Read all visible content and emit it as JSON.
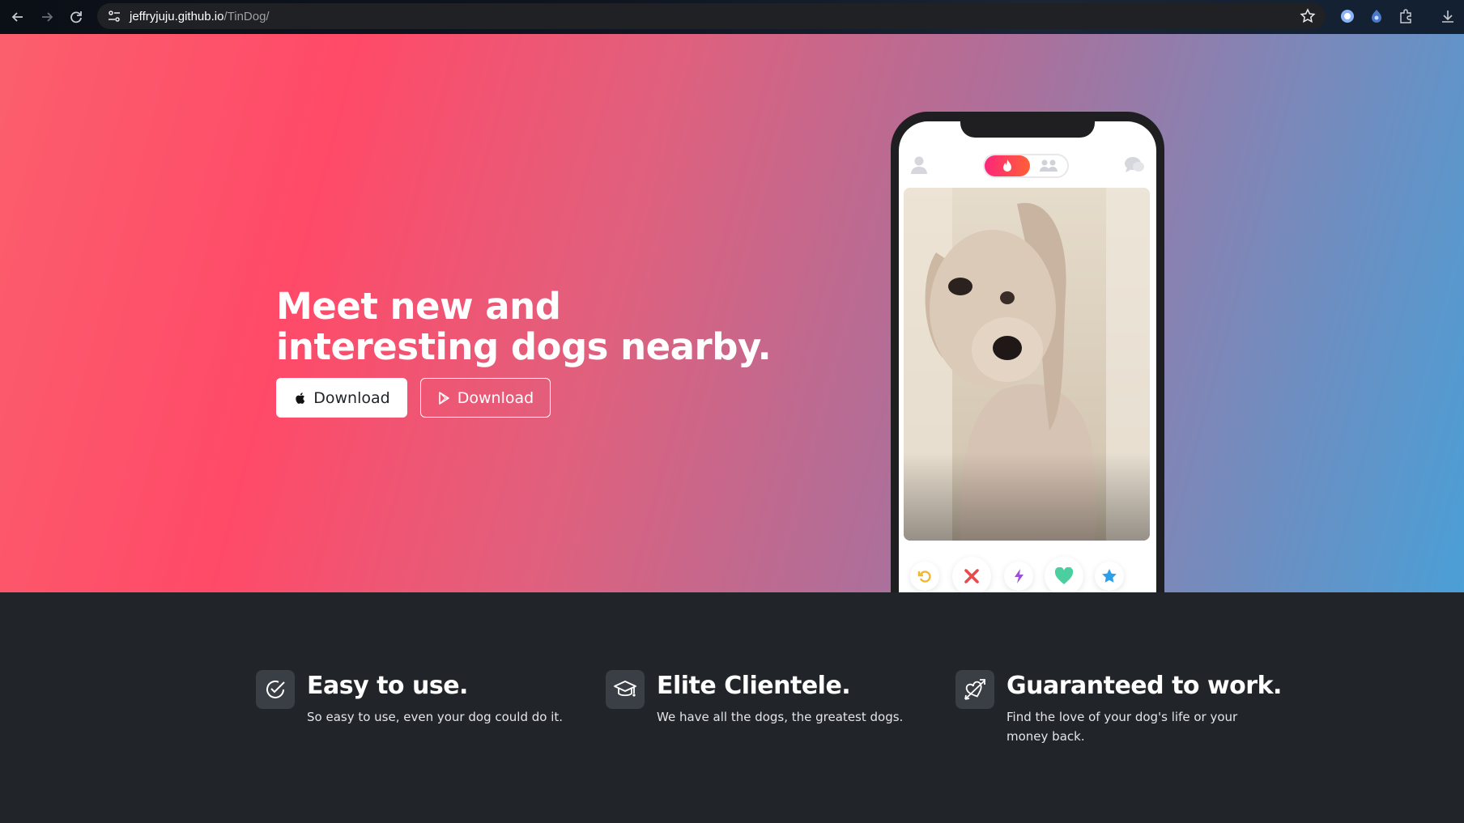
{
  "browser": {
    "url_host": "jeffryjuju.github.io",
    "url_path": "/TinDog/"
  },
  "hero": {
    "headline": "Meet new and interesting dogs nearby.",
    "apple_button_label": "Download",
    "play_button_label": "Download"
  },
  "phone_app": {
    "photo_subject": "dog",
    "action_buttons": [
      "rewind-icon",
      "nope-icon",
      "boost-icon",
      "like-icon",
      "super-like-icon"
    ]
  },
  "features": [
    {
      "icon": "check-circle-icon",
      "title": "Easy to use.",
      "description": "So easy to use, even your dog could do it."
    },
    {
      "icon": "graduation-cap-icon",
      "title": "Elite Clientele.",
      "description": "We have all the dogs, the greatest dogs."
    },
    {
      "icon": "heart-arrow-icon",
      "title": "Guaranteed to work.",
      "description": "Find the love of your dog's life or your money back."
    }
  ],
  "colors": {
    "hero_start": "#ff4a68",
    "hero_end": "#4a9fd6",
    "features_bg": "#212529"
  }
}
